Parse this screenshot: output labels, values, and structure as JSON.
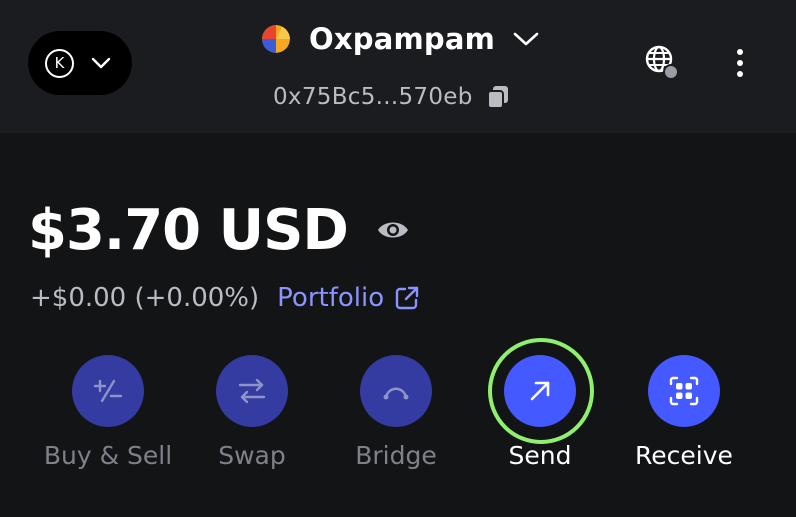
{
  "header": {
    "network_initial": "K",
    "account_name": "Oxpampam",
    "address": "0x75Bc5...570eb"
  },
  "balance": {
    "amount": "$3.70 USD",
    "change": "+$0.00 (+0.00%)",
    "portfolio_label": "Portfolio"
  },
  "actions": [
    {
      "label": "Buy & Sell",
      "icon": "buy-sell-icon",
      "enabled": false
    },
    {
      "label": "Swap",
      "icon": "swap-icon",
      "enabled": false
    },
    {
      "label": "Bridge",
      "icon": "bridge-icon",
      "enabled": false
    },
    {
      "label": "Send",
      "icon": "send-arrow-icon",
      "enabled": true,
      "highlighted": true
    },
    {
      "label": "Receive",
      "icon": "qr-code-icon",
      "enabled": true
    }
  ],
  "colors": {
    "background": "#131416",
    "header_background": "#1b1c1f",
    "primary": "#4459ff",
    "primary_disabled": "#343ba1",
    "link": "#8b93ff",
    "highlight_ring": "#8ff06e",
    "muted_text": "#b9bcc3"
  }
}
